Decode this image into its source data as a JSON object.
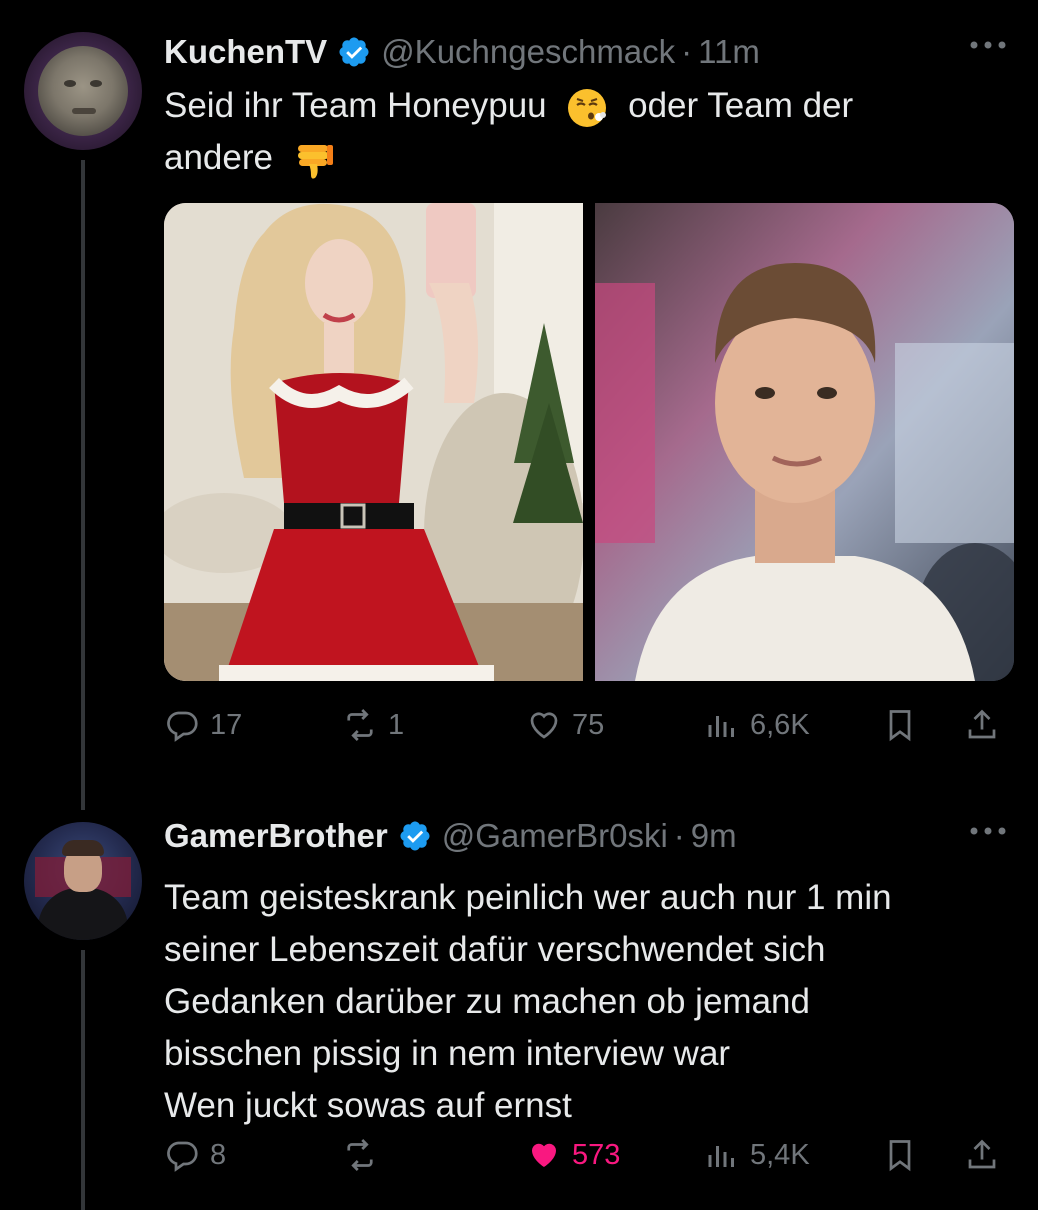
{
  "tweets": [
    {
      "author_name": "KuchenTV",
      "handle": "@Kuchngeschmack",
      "separator": "·",
      "time": "11m",
      "text_parts": {
        "line1_a": "Seid ihr Team Honeypuu",
        "line1_b": "oder Team der",
        "line2": "andere"
      },
      "emojis": [
        "face-exhaling-emoji",
        "thumbs-down-emoji"
      ],
      "stats": {
        "replies": "17",
        "retweets": "1",
        "likes": "75",
        "views": "6,6K"
      },
      "liked": false
    },
    {
      "author_name": "GamerBrother",
      "handle": "@GamerBr0ski",
      "separator": "·",
      "time": "9m",
      "text_lines": [
        "Team geisteskrank peinlich wer auch nur 1 min",
        "seiner Lebenszeit dafür verschwendet sich",
        "Gedanken darüber zu machen ob jemand",
        "bisschen pissig in nem interview war",
        "Wen juckt sowas auf ernst"
      ],
      "stats": {
        "replies": "8",
        "retweets": "",
        "likes": "573",
        "views": "5,4K"
      },
      "liked": true
    }
  ],
  "colors": {
    "background": "#000000",
    "text": "#e7e9ea",
    "secondary": "#71767b",
    "verified": "#1d9bf0",
    "like": "#f91880",
    "thread_line": "#333639"
  }
}
